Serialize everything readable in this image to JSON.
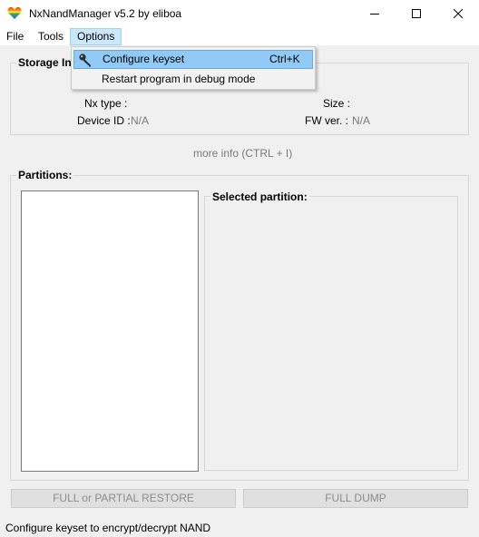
{
  "window": {
    "title": "NxNandManager v5.2 by eliboa",
    "icon": "rainbow-heart-icon",
    "controls": [
      "minimize-icon",
      "maximize-icon",
      "close-icon"
    ]
  },
  "menu": {
    "file": "File",
    "tools": "Tools",
    "options": "Options"
  },
  "dropdown": {
    "items": [
      {
        "label": "Configure keyset",
        "shortcut": "Ctrl+K",
        "icon": "key-icon",
        "highlighted": true
      },
      {
        "label": "Restart program in debug mode",
        "shortcut": ""
      }
    ]
  },
  "storage": {
    "title": "Storage In",
    "nx_type_label": "Nx type :",
    "nx_type_value": "",
    "size_label": "Size :",
    "size_value": "",
    "device_id_label": "Device ID :",
    "device_id_value": "N/A",
    "fw_ver_label": "FW ver. :",
    "fw_ver_value": "N/A"
  },
  "more_info": "more info (CTRL + I)",
  "partitions": {
    "title": "Partitions:",
    "selected_title": "Selected partition:",
    "items": []
  },
  "buttons": {
    "restore": "FULL or PARTIAL RESTORE",
    "dump": "FULL DUMP"
  },
  "status": "Configure keyset to encrypt/decrypt NAND",
  "colors": {
    "menu_highlight": "#cce8ff",
    "dropdown_highlight": "#91c9f7",
    "disabled_text": "#8d8d8d"
  }
}
